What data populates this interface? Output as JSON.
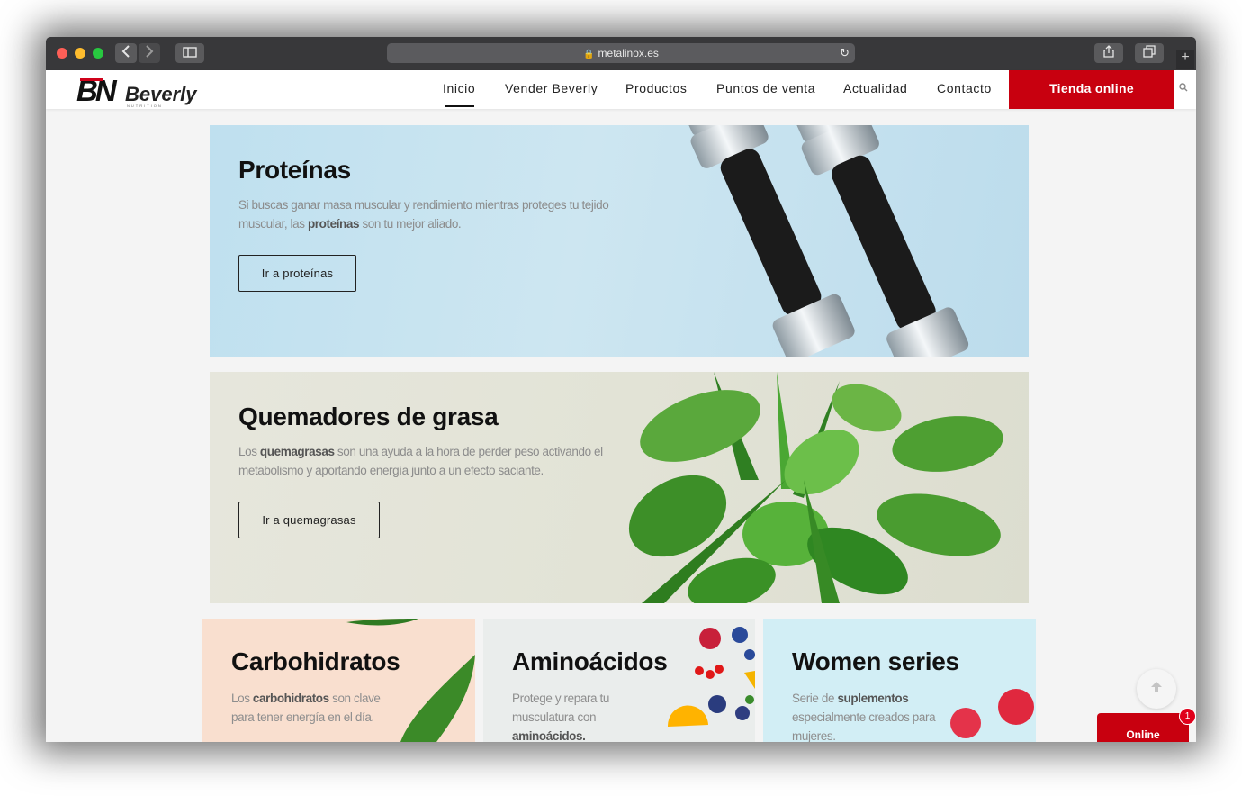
{
  "browser": {
    "url": "metalinox.es",
    "back_icon": "chevron-left-icon",
    "forward_icon": "chevron-right-icon"
  },
  "site": {
    "logo_main": "BN",
    "logo_brand": "Beverly",
    "logo_sub": "NUTRITION"
  },
  "nav": {
    "items": [
      {
        "label": "Inicio"
      },
      {
        "label": "Vender Beverly"
      },
      {
        "label": "Productos"
      },
      {
        "label": "Puntos de venta"
      },
      {
        "label": "Actualidad"
      },
      {
        "label": "Contacto"
      }
    ],
    "active": "Inicio",
    "shop_label": "Tienda online"
  },
  "banners": [
    {
      "title": "Proteínas",
      "text_before": "Si buscas ganar masa muscular y rendimiento mientras proteges tu tejido muscular, las ",
      "text_bold": "proteínas",
      "text_after": " son tu mejor aliado.",
      "button": "Ir a proteínas"
    },
    {
      "title": "Quemadores de grasa",
      "text_before": "Los ",
      "text_bold": "quemagrasas",
      "text_after": " son una ayuda a la hora de perder peso activando el metabolismo y aportando energía junto a un efecto saciante.",
      "button": "Ir a quemagrasas"
    }
  ],
  "cards": [
    {
      "title": "Carbohidratos",
      "text_before": "Los ",
      "text_bold": "carbohidratos",
      "text_after": " son clave para tener energía en el día."
    },
    {
      "title": "Aminoácidos",
      "text_before": "Protege y repara tu musculatura con ",
      "text_bold": "aminoácidos.",
      "text_after": ""
    },
    {
      "title": "Women series",
      "text_before": "Serie de ",
      "text_bold": "suplementos",
      "text_after": " especialmente creados para mujeres."
    }
  ],
  "chat": {
    "label": "Online",
    "badge": "1"
  },
  "colors": {
    "brand_red": "#c8000f",
    "text_dark": "#111111"
  }
}
